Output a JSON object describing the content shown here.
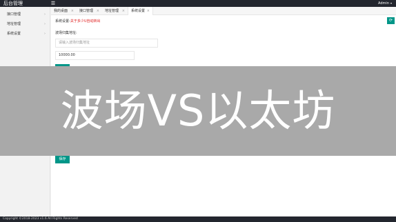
{
  "header": {
    "brand": "后台管理",
    "menu_icon": "menu-icon",
    "user": "Admin",
    "user_caret": "▾"
  },
  "sidebar": {
    "items": [
      {
        "label": "接口管理",
        "chevron": "›"
      },
      {
        "label": "地址管理",
        "chevron": "›"
      },
      {
        "label": "系统设置",
        "chevron": "›"
      }
    ]
  },
  "tabs": [
    {
      "label": "我的桌面",
      "close": "×"
    },
    {
      "label": "接口管理",
      "close": "×"
    },
    {
      "label": "地址管理",
      "close": "×"
    },
    {
      "label": "系统设置",
      "close": "×"
    }
  ],
  "breadcrumb": {
    "prefix": "系统设置-",
    "warning": "关于多少U自动转出"
  },
  "refresh_icon": "⟳",
  "form": {
    "address_label": "波场归集地址:",
    "address_placeholder": "请输入波场归集地址",
    "amount_value": "10000.00",
    "save_label": "保存"
  },
  "overlay": {
    "text": "波场VS以太坊"
  },
  "footer": {
    "text": "Copyright ©2018-2023 v1.6 All Rights Reserved"
  }
}
